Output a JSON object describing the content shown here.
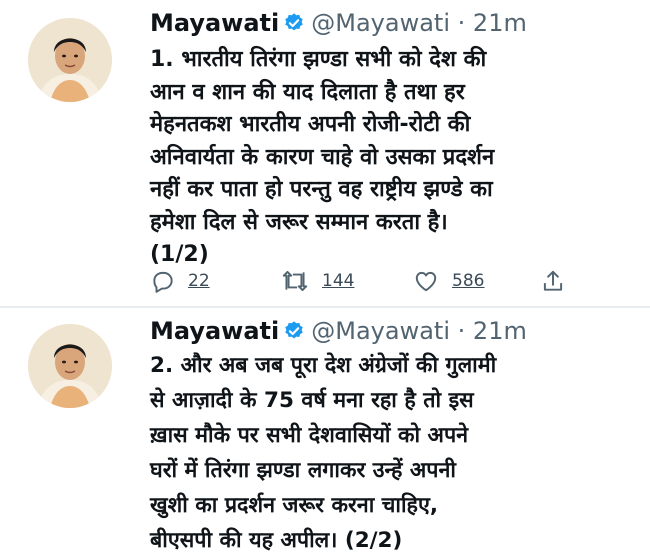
{
  "tweets": [
    {
      "name": "Mayawati",
      "handle": "@Mayawati",
      "separator": "·",
      "time": "21m",
      "lines": [
        "1. भारतीय तिरंगा झण्डा सभी को देश की",
        "आन व शान की याद दिलाता है तथा हर",
        "मेहनतकश भारतीय अपनी रोजी-रोटी की",
        "अनिवार्यता के कारण चाहे वो उसका प्रदर्शन",
        "नहीं कर पाता हो परन्तु वह राष्ट्रीय झण्डे का",
        "हमेशा दिल से जरूर सम्मान करता है।",
        "(1/2)"
      ],
      "replies": "22",
      "retweets": "144",
      "likes": "586"
    },
    {
      "name": "Mayawati",
      "handle": "@Mayawati",
      "separator": "·",
      "time": "21m",
      "lines": [
        "2. और अब जब पूरा देश अंग्रेजों की गुलामी",
        "से आज़ादी के 75 वर्ष मना रहा है तो इस",
        "ख़ास मौके पर सभी देशवासियों को अपने",
        "घरों में तिरंगा झण्डा लगाकर उन्हें अपनी",
        "खुशी का प्रदर्शन जरूर करना चाहिए,",
        "बीएसपी की यह अपील। (2/2)"
      ]
    }
  ],
  "icons": {
    "verified": "verified-badge-icon",
    "reply": "reply-icon",
    "retweet": "retweet-icon",
    "like": "like-icon",
    "share": "share-icon"
  },
  "colors": {
    "verified": "#1d9bf0",
    "secondary_text": "#536471",
    "divider": "#e6ecf0"
  }
}
